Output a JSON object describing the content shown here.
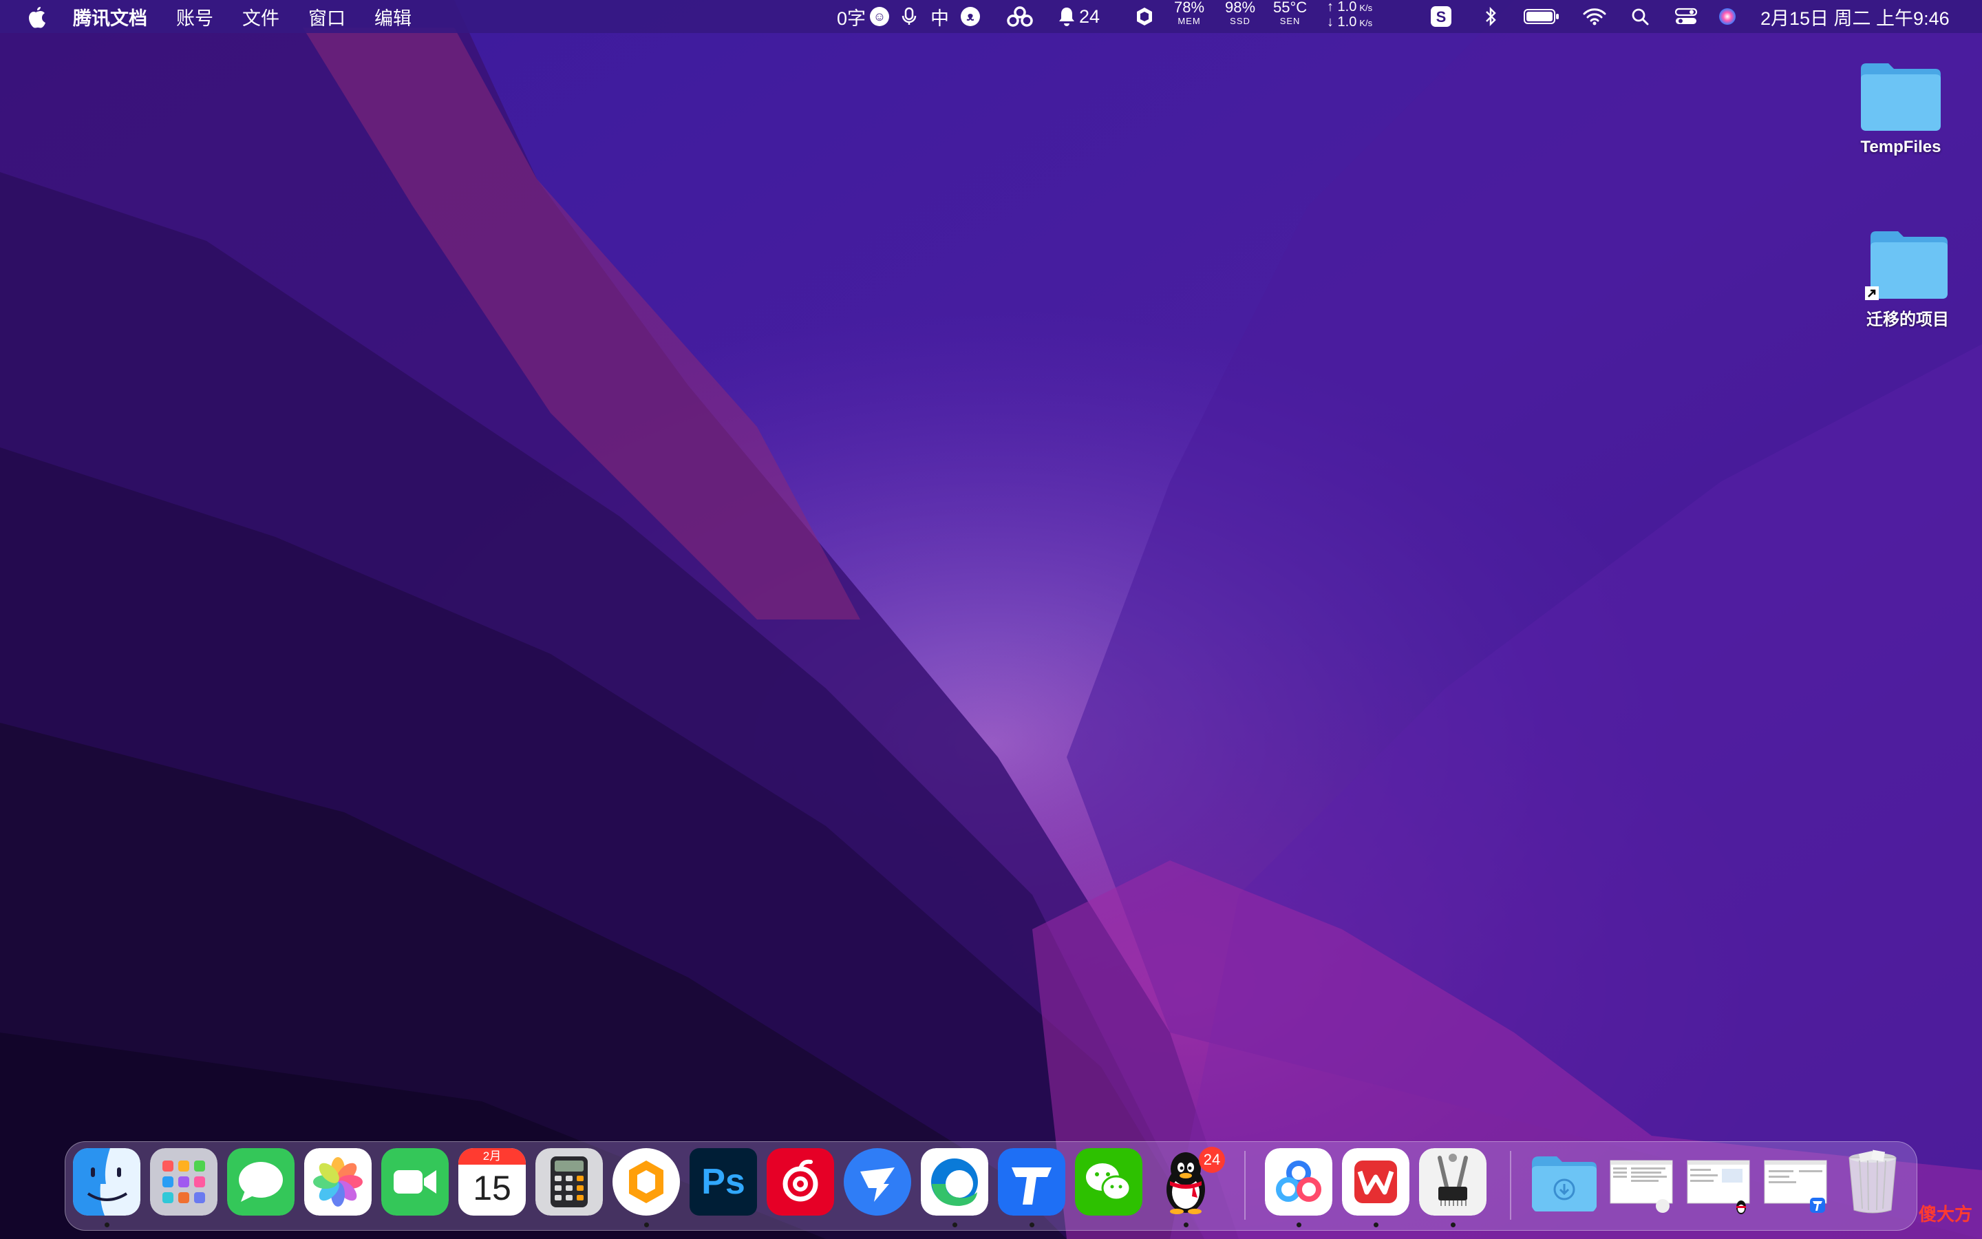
{
  "menubar": {
    "app_name": "腾讯文档",
    "menus": [
      "账号",
      "文件",
      "窗口",
      "编辑"
    ],
    "word_count": "0字",
    "ime_label": "中",
    "notification_count": "24",
    "mem": {
      "value": "78%",
      "label": "MEM"
    },
    "ssd": {
      "value": "98%",
      "label": "SSD"
    },
    "sen": {
      "value": "55°C",
      "label": "SEN"
    },
    "net_up": "↑ 1.0",
    "net_down": "↓ 1.0",
    "net_unit": "K/s",
    "datetime": "2月15日 周二 上午9:46"
  },
  "desktop": {
    "icons": [
      {
        "label": "TempFiles"
      },
      {
        "label": "迁移的项目"
      }
    ]
  },
  "dock": {
    "calendar_month": "2月",
    "calendar_day": "15",
    "qq_badge": "24",
    "ps_label": "Ps",
    "apps": [
      "finder",
      "launchpad",
      "messages",
      "photos",
      "facetime",
      "calendar",
      "calculator",
      "app-hexagon",
      "photoshop",
      "netease-music",
      "dingtalk",
      "edge",
      "tencent-docs",
      "wechat",
      "qq",
      "baidu-netdisk",
      "wps",
      "system-info",
      "downloads",
      "window-1",
      "window-2",
      "window-3",
      "trash"
    ]
  },
  "watermark": "傻大方",
  "colors": {
    "accent": "#361882",
    "badge": "#ff3b30",
    "folder": "#5fb8ef"
  }
}
